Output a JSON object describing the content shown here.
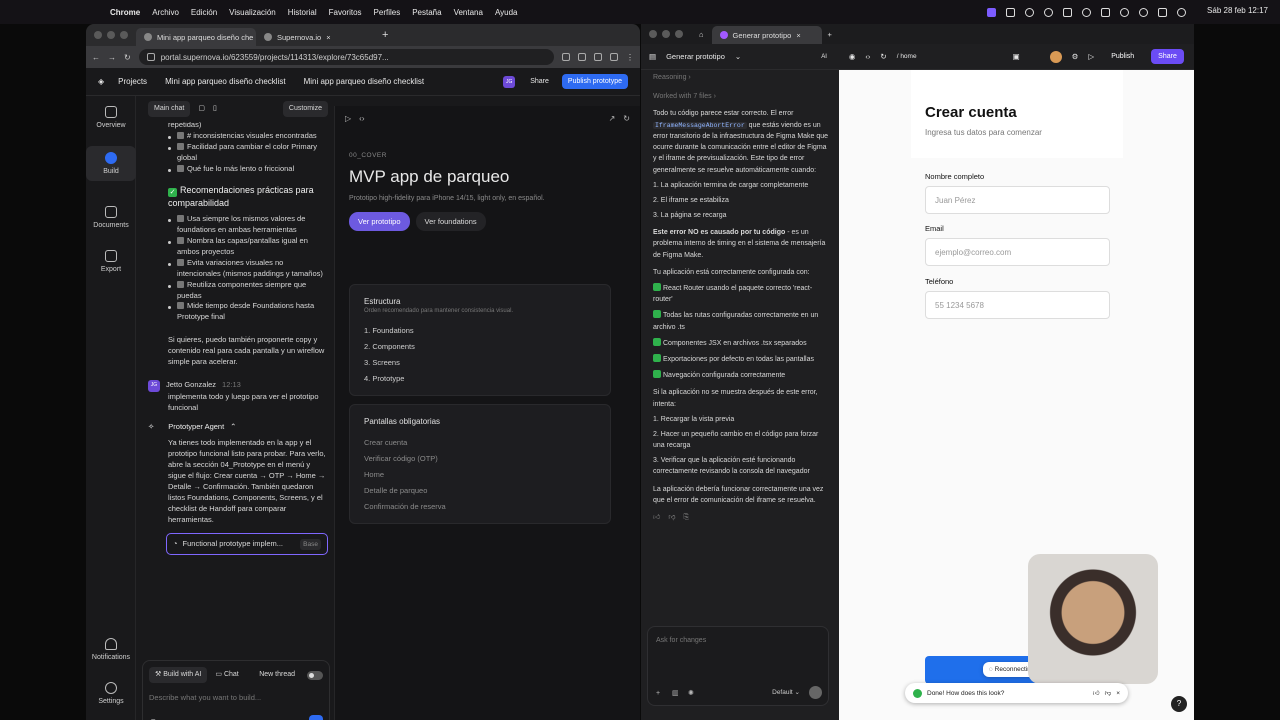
{
  "menubar": {
    "app": "Chrome",
    "items": [
      "Archivo",
      "Edición",
      "Visualización",
      "Historial",
      "Favoritos",
      "Perfiles",
      "Pestaña",
      "Ventana",
      "Ayuda"
    ],
    "clock": "Sáb 28 feb  12:17"
  },
  "left_window": {
    "tabs": [
      "Mini app parqueo diseño che",
      "Supernova.io"
    ],
    "url": "portal.supernova.io/623559/projects/114313/explore/73c65d97...",
    "header": {
      "projects": "Projects",
      "crumb1": "Mini app parqueo diseño checklist",
      "crumb2": "Mini app parqueo diseño checklist",
      "avatar": "JG",
      "share": "Share",
      "publish": "Publish prototype"
    },
    "rail": [
      "Overview",
      "Build",
      "Documents",
      "Export",
      "Notifications",
      "Settings"
    ],
    "chat": {
      "main_chat": "Main chat",
      "customize": "Customize",
      "top_fragment": "repetidas)",
      "checklist1": [
        "# inconsistencias visuales encontradas",
        "Facilidad para cambiar el color Primary global",
        "Qué fue lo más lento o friccional"
      ],
      "rec_title": "Recomendaciones prácticas para comparabilidad",
      "checklist2": [
        "Usa siempre los mismos valores de foundations en ambas herramientas",
        "Nombra las capas/pantallas igual en ambos proyectos",
        "Evita variaciones visuales no intencionales (mismos paddings y tamaños)",
        "Reutiliza componentes siempre que puedas",
        "Mide tiempo desde Foundations hasta Prototype final"
      ],
      "offer": "Si quieres, puedo también proponerte copy y contenido real para cada pantalla y un wireflow simple para acelerar.",
      "user_initials": "JG",
      "user_name": "Jetto Gonzalez",
      "user_time": "12:13",
      "user_msg": "implementa todo y luego para ver el prototipo funcional",
      "agent": "Prototyper Agent",
      "agent_msg": "Ya tienes todo implementado en la app y el prototipo funcional listo para probar. Para verlo, abre la sección 04_Prototype en el menú y sigue el flujo: Crear cuenta → OTP → Home → Detalle → Confirmación. También quedaron listos Foundations, Components, Screens, y el checklist de Handoff para comparar herramientas.",
      "result": "Functional prototype implem...",
      "result_tag": "Base",
      "mode_ai": "Build with AI",
      "mode_chat": "Chat",
      "new_thread": "New thread",
      "placeholder": "Describe what you want to build..."
    },
    "preview": {
      "label": "00_COVER",
      "title": "MVP app de parqueo",
      "subtitle": "Prototipo high-fidelity para iPhone 14/15, light only, en español.",
      "btn_primary": "Ver prototipo",
      "btn_secondary": "Ver foundations",
      "card1_title": "Estructura",
      "card1_sub": "Orden recomendado para mantener consistencia visual.",
      "card1_items": [
        "1. Foundations",
        "2. Components",
        "3. Screens",
        "4. Prototype"
      ],
      "card2_title": "Pantallas obligatorias",
      "card2_items": [
        "Crear cuenta",
        "Verificar código (OTP)",
        "Home",
        "Detalle de parqueo",
        "Confirmación de reserva"
      ]
    }
  },
  "right_window": {
    "tab": "Generar prototipo",
    "header_title": "Generar prototipo",
    "path": "/ home",
    "publish": "Publish",
    "share": "Share",
    "reasoning": "Reasoning",
    "worked": "Worked with 7 files",
    "p1_a": "Todo tu código parece estar correcto. El error",
    "p1_code": "IframeMessageAbortError",
    "p1_b": "que estás viendo es un error transitorio de la infraestructura de Figma Make que ocurre durante la comunicación entre el editor de Figma y el iframe de previsualización. Este tipo de error generalmente se resuelve automáticamente cuando:",
    "list1": [
      "1. La aplicación termina de cargar completamente",
      "2. El iframe se estabiliza",
      "3. La página se recarga"
    ],
    "p2_bold": "Este error NO es causado por tu código",
    "p2_rest": "- es un problema interno de timing en el sistema de mensajería de Figma Make.",
    "p3": "Tu aplicación está correctamente configurada con:",
    "checks": [
      "React Router usando el paquete correcto 'react-router'",
      "Todas las rutas configuradas correctamente en un archivo .ts",
      "Componentes JSX en archivos .tsx separados",
      "Exportaciones por defecto en todas las pantallas",
      "Navegación configurada correctamente"
    ],
    "p4": "Si la aplicación no se muestra después de este error, intenta:",
    "list2": [
      "1. Recargar la vista previa",
      "2. Hacer un pequeño cambio en el código para forzar una recarga",
      "3. Verificar que la aplicación esté funcionando correctamente revisando la consola del navegador"
    ],
    "p5": "La aplicación debería funcionar correctamente una vez que el error de comunicación del iframe se resuelva.",
    "ask_placeholder": "Ask for changes",
    "model": "Default",
    "phone": {
      "title": "Crear cuenta",
      "subtitle": "Ingresa tus datos para comenzar",
      "label_name": "Nombre completo",
      "ph_name": "Juan Pérez",
      "label_email": "Email",
      "ph_email": "ejemplo@correo.com",
      "label_phone": "Teléfono",
      "ph_phone": "55 1234 5678",
      "reconnecting": "Reconnecting"
    },
    "toast": "Done! How does this look?"
  }
}
